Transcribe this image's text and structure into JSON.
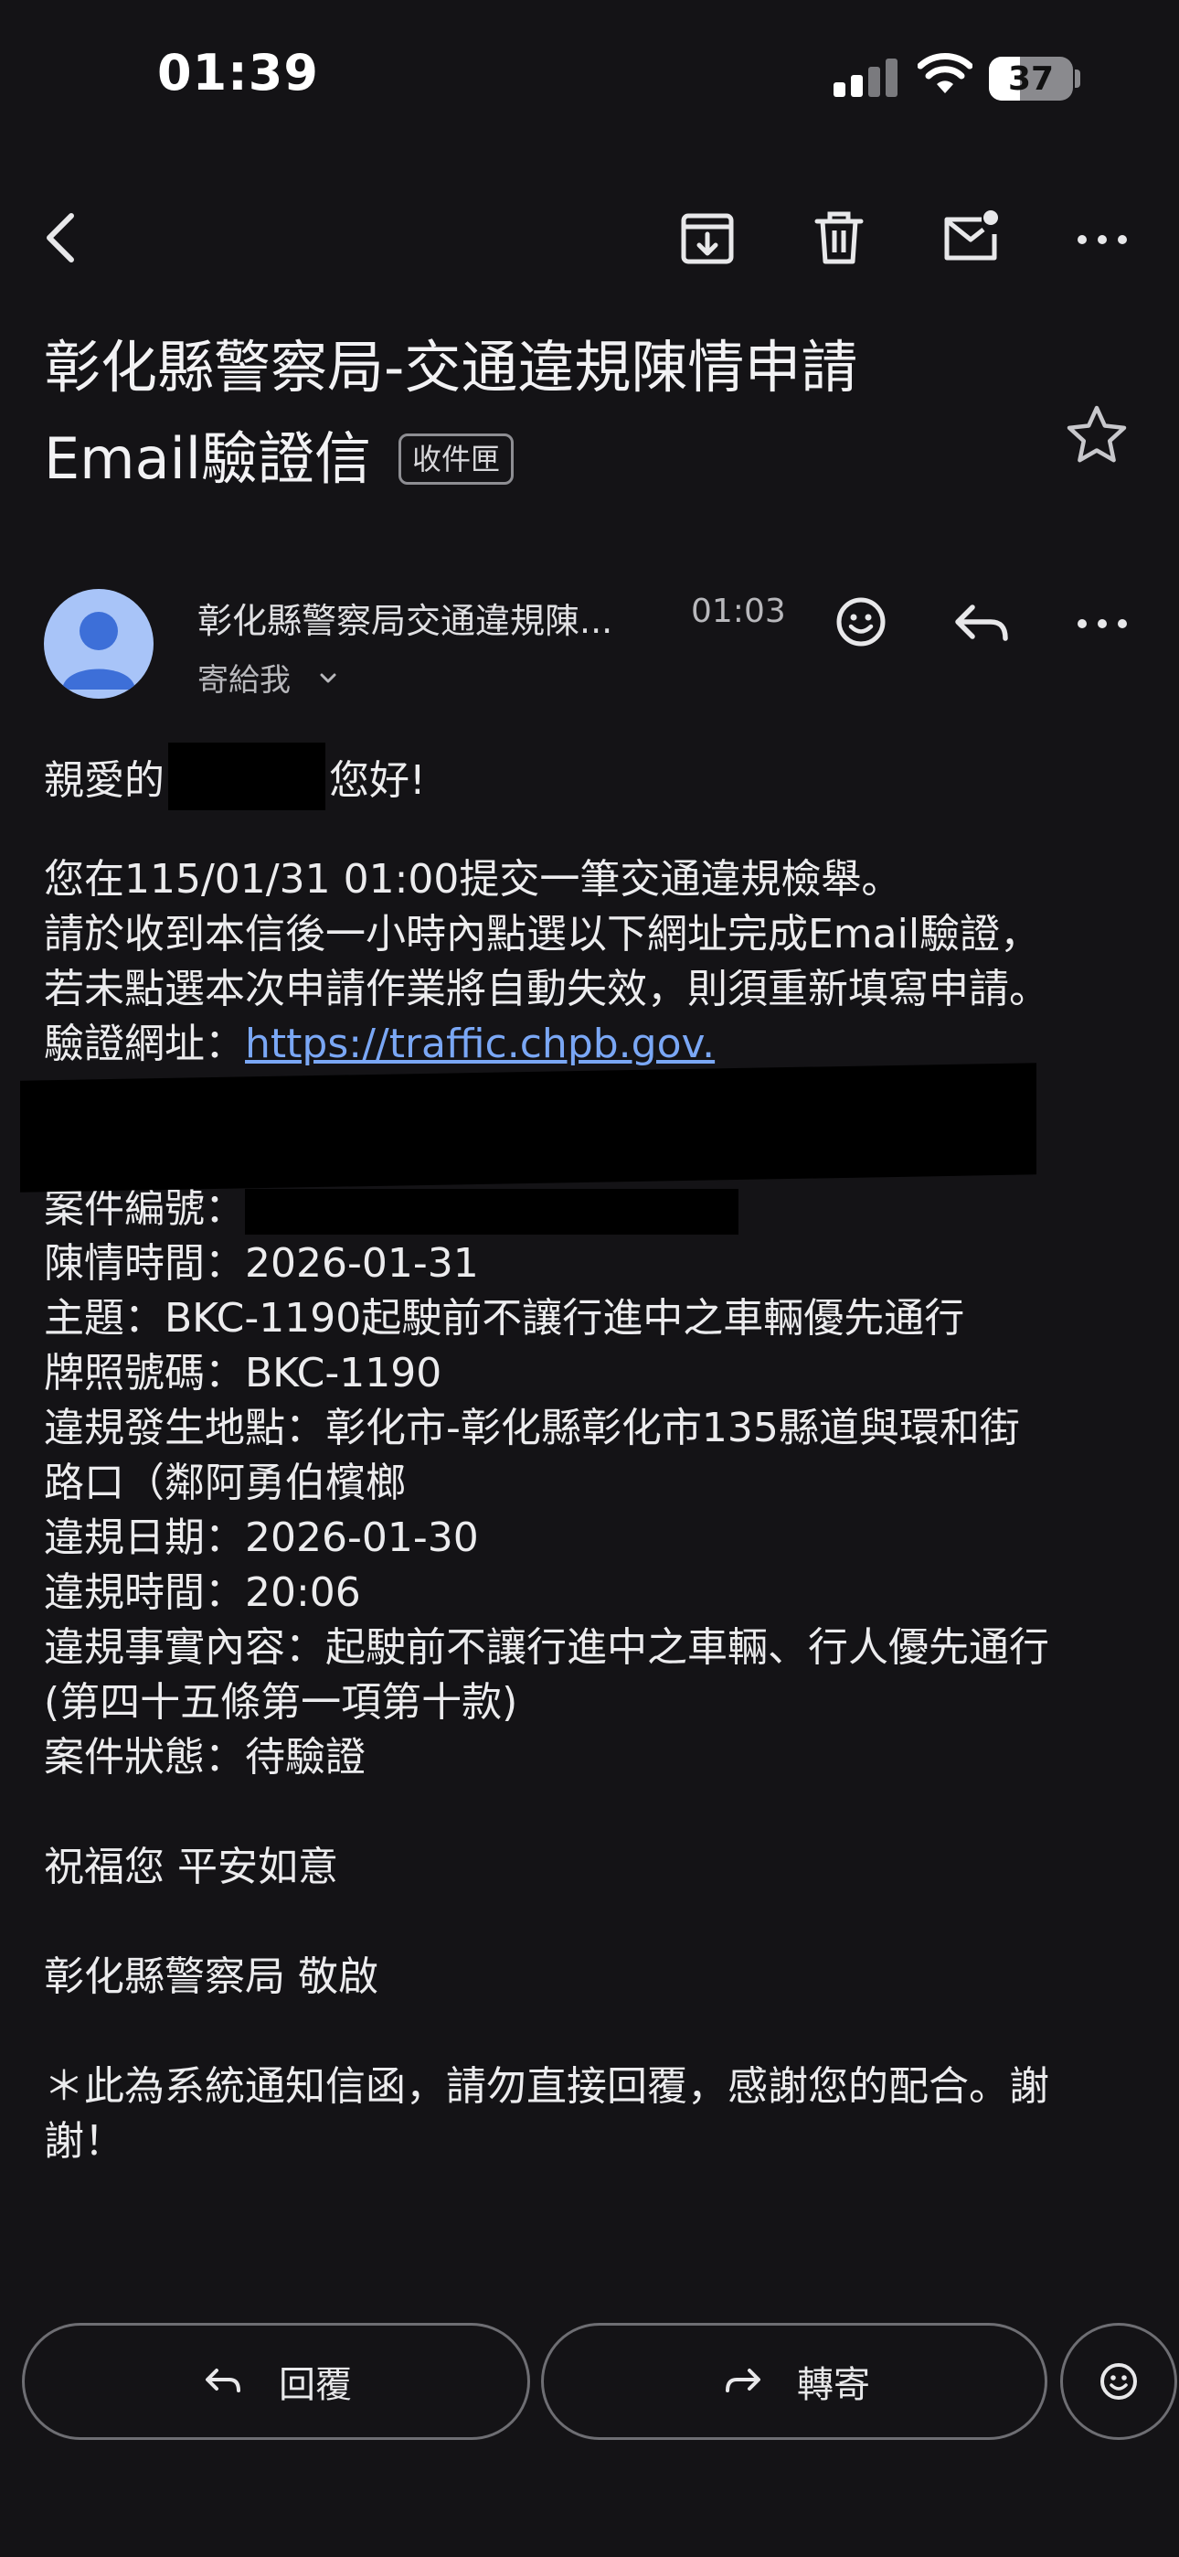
{
  "status_bar": {
    "time": "01:39",
    "battery": "37",
    "battery_level": 0.37
  },
  "toolbar": {
    "icons": [
      "back-arrow-icon",
      "archive-icon",
      "trash-icon",
      "mark-unread-icon",
      "more-icon"
    ]
  },
  "email": {
    "subject_line1": "彰化縣警察局-交通違規陳情申請",
    "subject_line2": "Email驗證信",
    "label_chip": "收件匣",
    "sender": "彰化縣警察局交通違規陳...",
    "time": "01:03",
    "to": "寄給我",
    "body": {
      "greeting_prefix": "親愛的",
      "greeting_suffix": "您好!",
      "p1": "您在115/01/31 01:00提交一筆交通違規檢舉。",
      "p2": "請於收到本信後一小時內點選以下網址完成Email驗證，",
      "p3": "若未點選本次申請作業將自動失效，則須重新填寫申請。",
      "verify_label": "驗證網址：",
      "verify_link": "https://traffic.chpb.gov.",
      "case_no_label": "案件編號：",
      "petition_time": "陳情時間：2026-01-31",
      "topic": "主題：BKC-1190起駛前不讓行進中之車輛優先通行",
      "plate": "牌照號碼：BKC-1190",
      "location_1": "違規發生地點：彰化市-彰化縣彰化市135縣道與環和街",
      "location_2": "路口（鄰阿勇伯檳榔",
      "violation_date": "違規日期：2026-01-30",
      "violation_time": "違規時間：20:06",
      "fact_1": "違規事實內容：起駛前不讓行進中之車輛、行人優先通行",
      "fact_2": "(第四十五條第一項第十款)",
      "status": "案件狀態：待驗證",
      "wish": "祝福您 平安如意",
      "signature": "彰化縣警察局 敬啟",
      "note_1": "＊此為系統通知信函，請勿直接回覆，感謝您的配合。謝",
      "note_2": "謝！"
    }
  },
  "actions": {
    "reply": "回覆",
    "forward": "轉寄"
  },
  "colors": {
    "background": "#141316",
    "link": "#7aa7f5",
    "avatar": "#a8c4f8"
  }
}
